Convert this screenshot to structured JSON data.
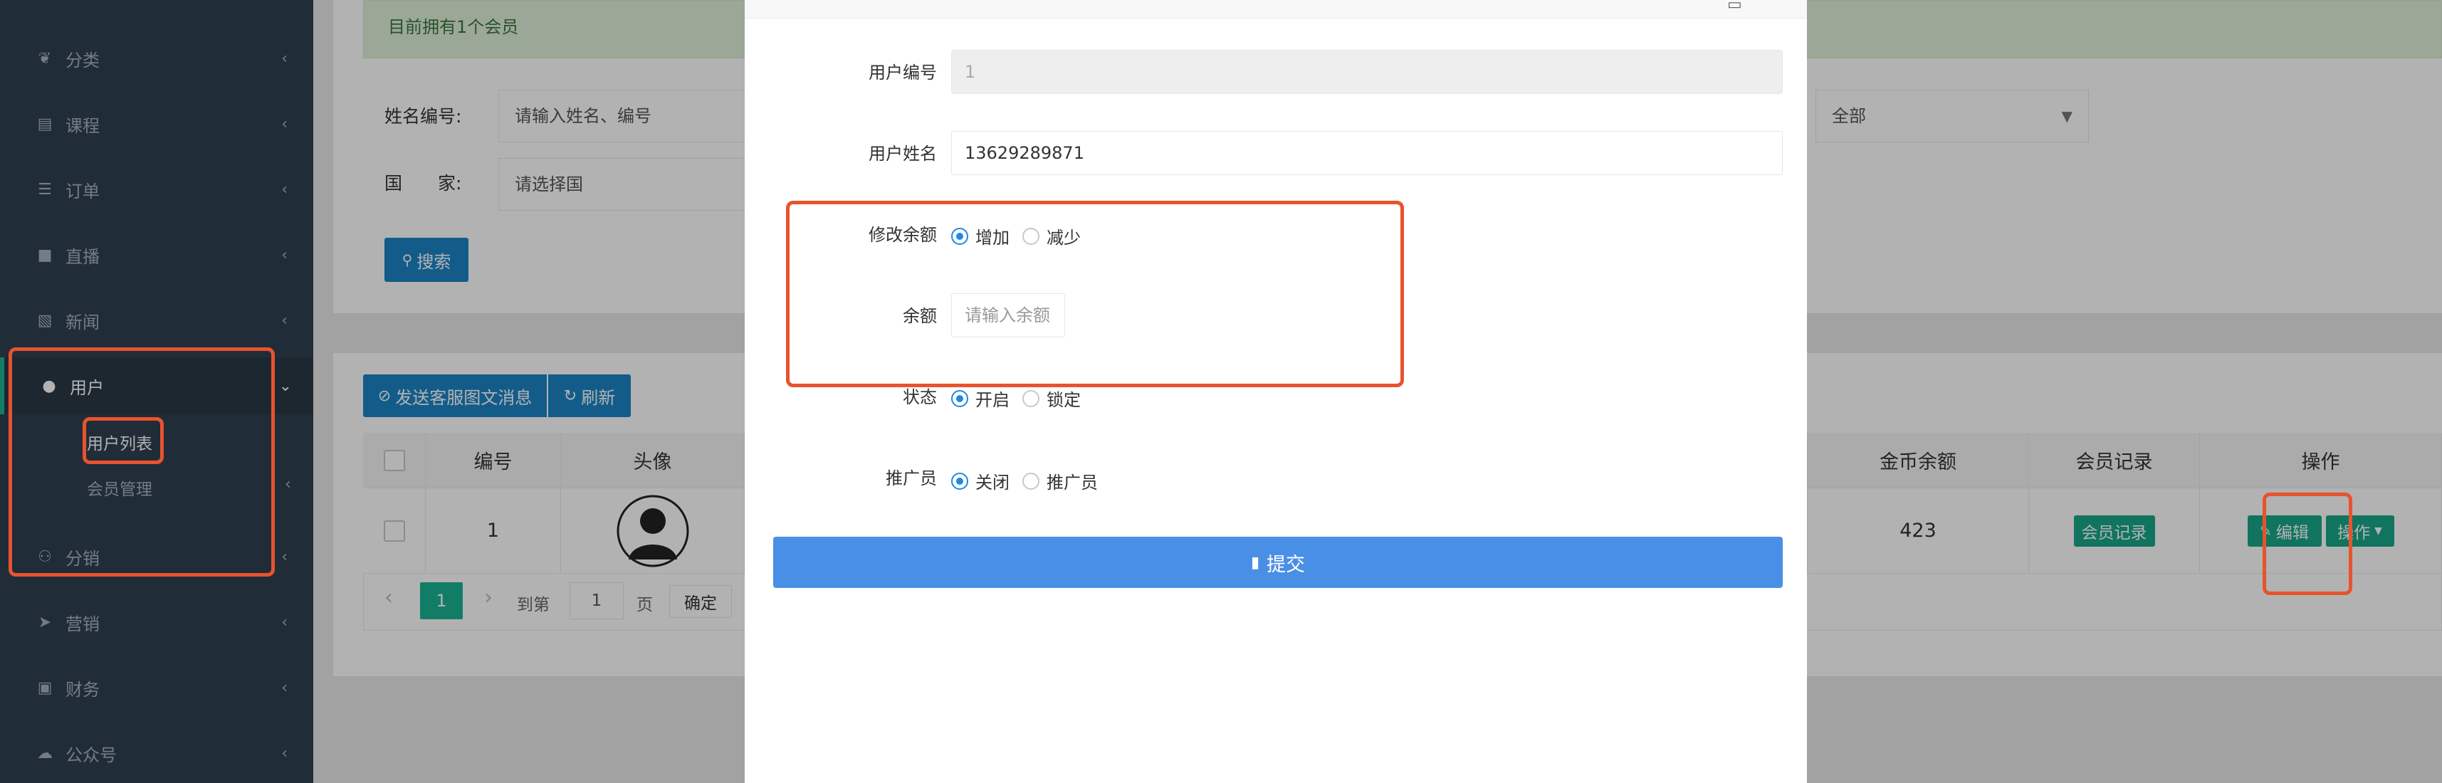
{
  "sidebar": {
    "items": [
      {
        "label": "分类",
        "icon": "leaf-icon"
      },
      {
        "label": "课程",
        "icon": "book-icon"
      },
      {
        "label": "订单",
        "icon": "list-icon"
      },
      {
        "label": "直播",
        "icon": "video-icon"
      },
      {
        "label": "新闻",
        "icon": "image-icon"
      },
      {
        "label": "用户",
        "icon": "user-icon"
      },
      {
        "label": "分销",
        "icon": "users-icon"
      },
      {
        "label": "营销",
        "icon": "send-icon"
      },
      {
        "label": "财务",
        "icon": "money-icon"
      },
      {
        "label": "公众号",
        "icon": "wechat-icon"
      }
    ],
    "user_sub": [
      "用户列表",
      "会员管理"
    ]
  },
  "alert": "目前拥有1个会员",
  "search": {
    "name_label": "姓名编号:",
    "name_placeholder": "请输入姓名、编号",
    "country_label": "国　　家:",
    "country_placeholder": "请选择国",
    "select_value": "全部",
    "search_button": "搜索"
  },
  "toolbar": {
    "send_msg": "发送客服图文消息",
    "refresh": "刷新"
  },
  "table": {
    "headers": {
      "id": "编号",
      "avatar": "头像",
      "balance": "金币余额",
      "record": "会员记录",
      "ops": "操作"
    },
    "row": {
      "id": "1",
      "balance": "423",
      "record": "会员记录",
      "edit": "编辑",
      "more": "操作"
    }
  },
  "pagination": {
    "page": "1",
    "goto": "到第",
    "goto_value": "1",
    "page_unit": "页",
    "confirm": "确定"
  },
  "modal": {
    "user_id_label": "用户编号",
    "user_id_value": "1",
    "user_name_label": "用户姓名",
    "user_name_value": "13629289871",
    "modify_label": "修改余额",
    "increase": "增加",
    "decrease": "减少",
    "balance_label": "余额",
    "balance_placeholder": "请输入余额",
    "status_label": "状态",
    "status_on": "开启",
    "status_lock": "锁定",
    "promoter_label": "推广员",
    "promoter_off": "关闭",
    "promoter_on": "推广员",
    "submit": "提交"
  },
  "colors": {
    "sidebar": "#2f4050",
    "primary": "#1c84c6",
    "green": "#1ab394",
    "submit": "#4a8fe6",
    "highlight": "#e8532e"
  }
}
